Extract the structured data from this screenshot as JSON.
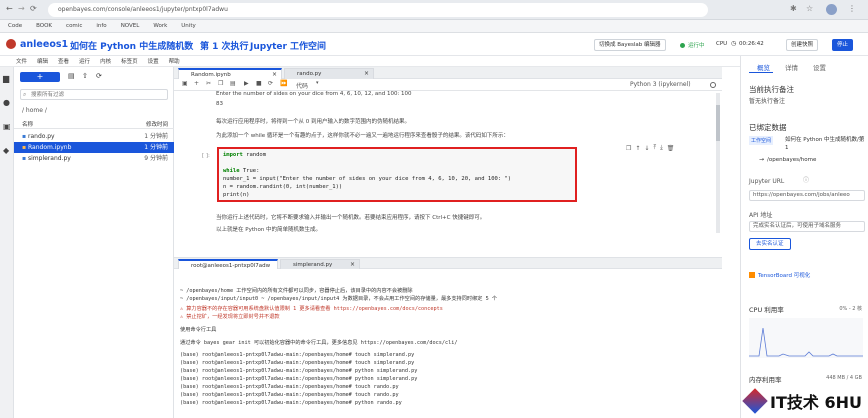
{
  "browser": {
    "url": "openbayes.com/console/anleeos1/jupyter/pntxp0l7adwu",
    "bookmarks": [
      "Code",
      "BOOK",
      "comic",
      "info",
      "NOVEL",
      "Work",
      "Unity"
    ]
  },
  "header": {
    "brand": "anleeos1",
    "title_parts": [
      "如何在 Python 中生成随机数",
      "第 1 次执行",
      "Jupyter 工作空间"
    ],
    "switch_editor": "切换成 Bayeslab 编辑器",
    "status": "运行中",
    "cpu_label": "CPU",
    "timer": "00:26:42",
    "create_snapshot": "创建快照",
    "stop": "停止"
  },
  "menubar": [
    "文件",
    "编辑",
    "查看",
    "运行",
    "内核",
    "标签页",
    "设置",
    "帮助"
  ],
  "filebrowser": {
    "new_button": "+",
    "search_placeholder": "搜索所有过滤",
    "path": "/ home /",
    "col_name": "名称",
    "col_modified": "修改时间",
    "files": [
      {
        "name": "rando.py",
        "time": "1 分钟前"
      },
      {
        "name": "Random.ipynb",
        "time": "1 分钟前"
      },
      {
        "name": "simplerand.py",
        "time": "9 分钟前"
      }
    ]
  },
  "notebook": {
    "tabs": [
      "Random.ipynb",
      "rando.py"
    ],
    "cell_type": "代码",
    "kernel": "Python 3 (ipykernel)",
    "text_lines": [
      "Enter the number of sides on your dice from 4, 6, 10, 12, and 100: 100",
      "83",
      "每次运行应用程序时，将得到一个从 0 到用户输入的数字范围内的伪随机结果。",
      "为此添加一个 while 循环是一个有趣的点子，这样你就不必一遍又一遍地运行程序来查看骰子的结果。该代码如下所示："
    ],
    "cell_prompt": "[ ]:",
    "code": [
      {
        "kw": "import",
        "rest": " random"
      },
      {
        "kw": "",
        "rest": ""
      },
      {
        "kw": "while",
        "rest": " True:"
      },
      {
        "kw": "",
        "rest": "    number_1 = input(\"Enter the number of sides on your dice from 4, 6, 10, 20, and 100: \")"
      },
      {
        "kw": "",
        "rest": "    n = random.randint(0, int(number_1))"
      },
      {
        "kw": "",
        "rest": "    print(n)"
      }
    ],
    "after_lines": [
      "当你运行上述代码时，它将不断要求输入并输出一个随机数。若要结束应用程序，请按下 Ctrl+C 快捷键即可。",
      "以上就是在 Python 中的简单随机数生成。"
    ]
  },
  "terminal": {
    "tabs": [
      "root@anleeos1-pntxp0l7adw",
      "simplerand.py"
    ],
    "lines": [
      {
        "text": "~ /openbayes/home 工作空间内的所有文件都可以同步，容器停止后，该目录中的内容不会被删除",
        "warn": false
      },
      {
        "text": "~ /openbayes/input/input0 ~ /openbayes/input/input4 为数据目录，不会占用工作空间的存储量，最多支持同时绑定 5 个",
        "warn": false
      },
      {
        "text": "⚠ 算力容器不的存在容器可用系统盘默认值限制 1 更多请看查看 https://openbayes.com/docs/concepts",
        "warn": true
      },
      {
        "text": "⚠ 禁止挖矿，一经发现将立即封号并不退款",
        "warn": true
      },
      {
        "text": "使用命令行工具",
        "warn": false
      },
      {
        "text": "通过命令 bayes gear init 可以初始化容器中的命令行工具，更多信息见 https://openbayes.com/docs/cli/",
        "warn": false
      },
      {
        "text": "(base) root@anleeos1-pntxp0l7adwu-main:/openbayes/home# touch simplerand.py",
        "warn": false
      },
      {
        "text": "(base) root@anleeos1-pntxp0l7adwu-main:/openbayes/home# touch simplerand.py",
        "warn": false
      },
      {
        "text": "(base) root@anleeos1-pntxp0l7adwu-main:/openbayes/home# python simplerand.py",
        "warn": false
      },
      {
        "text": "(base) root@anleeos1-pntxp0l7adwu-main:/openbayes/home# python simplerand.py",
        "warn": false
      },
      {
        "text": "(base) root@anleeos1-pntxp0l7adwu-main:/openbayes/home# touch rando.py",
        "warn": false
      },
      {
        "text": "(base) root@anleeos1-pntxp0l7adwu-main:/openbayes/home# touch rando.py",
        "warn": false
      },
      {
        "text": "(base) root@anleeos1-pntxp0l7adwu-main:/openbayes/home# python rando.py",
        "warn": false
      }
    ]
  },
  "right_panel": {
    "tabs": [
      "概览",
      "详情",
      "设置"
    ],
    "current_note_title": "当前执行备注",
    "current_note_value": "暂无执行备注",
    "bound_data_title": "已绑定数据",
    "workspace_badge": "工作空间",
    "workspace_name": "如何在 Python 中生成随机数/第 1",
    "workspace_path": "/openbayes/home",
    "jupyter_url_label": "Jupyter URL",
    "jupyter_url": "https://openbayes.com/jobs/anleeo",
    "api_label": "API 地址",
    "api_placeholder": "完成实名认证后，可使用子域名服务",
    "verify_button": "去实名认证",
    "tensorboard": "TensorBoard 可视化",
    "cpu_usage_label": "CPU 利用率",
    "cpu_range": "0% - 2 核",
    "memory_label": "内存利用率",
    "memory_range": "448 MB / 4 GB"
  },
  "watermark": "IT技术 6HU",
  "colors": {
    "accent": "#1a56db",
    "highlight": "#e02020",
    "green": "#2ea44f"
  }
}
